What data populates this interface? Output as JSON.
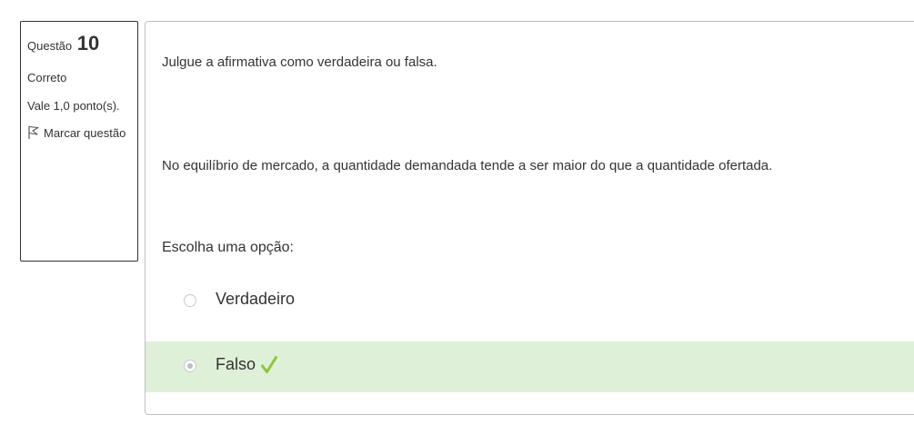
{
  "question_info": {
    "label": "Questão",
    "number": "10",
    "state": "Correto",
    "grade": "Vale 1,0 ponto(s).",
    "flag_label": "Marcar questão"
  },
  "question": {
    "instruction": "Julgue a afirmativa como verdadeira ou falsa.",
    "statement": "No equilíbrio de mercado, a quantidade demandada tende a ser maior do que a quantidade ofertada.",
    "prompt": "Escolha uma opção:"
  },
  "options": [
    {
      "label": "Verdadeiro",
      "selected": false,
      "correct": false
    },
    {
      "label": "Falso",
      "selected": true,
      "correct": true
    }
  ],
  "colors": {
    "correct_bg": "#dff0d8",
    "check_mark": "#8cc63f"
  },
  "icons": {
    "flag": "flag-icon",
    "correct": "check-icon"
  }
}
